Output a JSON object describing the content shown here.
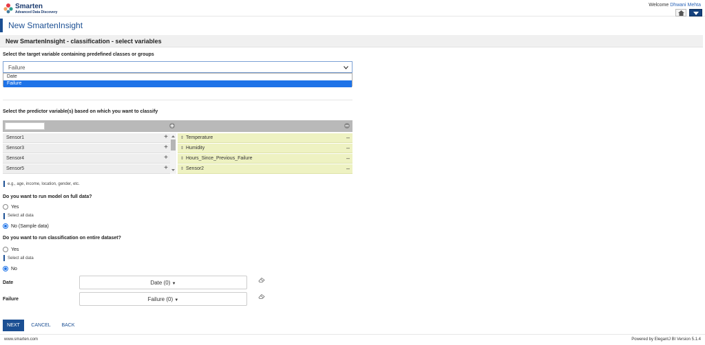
{
  "brand": {
    "name": "Smarten",
    "tagline": "Advanced Data Discovery"
  },
  "header": {
    "welcome": "Welcome",
    "user": "Dhwani Mehta"
  },
  "page_title": "New SmartenInsight",
  "section_title": "New SmartenInsight - classification - select variables",
  "target": {
    "label": "Select the target variable containing predefined classes or groups",
    "selected": "Failure",
    "options": [
      "Date",
      "Failure"
    ]
  },
  "predictors": {
    "label": "Select the predictor variable(s) based on which you want to classify",
    "available": [
      "Sensor1",
      "Sensor3",
      "Sensor4",
      "Sensor5"
    ],
    "selected": [
      "Temperature",
      "Humidity",
      "Hours_Since_Previous_Failure",
      "Sensor2"
    ],
    "hint": "e.g., age, income, location, gender, etc."
  },
  "full_data": {
    "question": "Do you want to run model on full data?",
    "yes": "Yes",
    "yes_hint": "Select all data",
    "no": "No (Sample data)"
  },
  "entire_dataset": {
    "question": "Do you want to run classification on entire dataset?",
    "yes": "Yes",
    "yes_hint": "Select all data",
    "no": "No"
  },
  "filters": [
    {
      "label": "Date",
      "value": "Date (0)"
    },
    {
      "label": "Failure",
      "value": "Failure (0)"
    }
  ],
  "buttons": {
    "next": "NEXT",
    "cancel": "CANCEL",
    "back": "BACK"
  },
  "footer": {
    "left": "www.smarten.com",
    "right": "Powered by ElegantJ BI Version 5.1.4"
  },
  "colors": {
    "brand": "#1b4f93",
    "accent": "#1e73e8",
    "selected_list": "#eef2c2"
  }
}
